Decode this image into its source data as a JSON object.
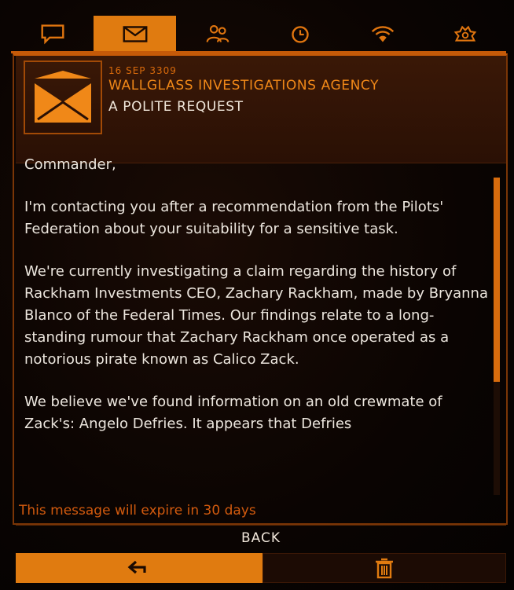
{
  "tabs": [
    {
      "icon": "chat-bubble-icon",
      "active": false
    },
    {
      "icon": "envelope-icon",
      "active": true
    },
    {
      "icon": "people-icon",
      "active": false
    },
    {
      "icon": "clock-icon",
      "active": false
    },
    {
      "icon": "wifi-shield-icon",
      "active": false
    },
    {
      "icon": "settings-cog-icon",
      "active": false
    }
  ],
  "message": {
    "date": "16 SEP 3309",
    "sender": "WALLGLASS INVESTIGATIONS AGENCY",
    "subject": "A POLITE REQUEST",
    "paragraphs": [
      "Commander,",
      "I'm contacting you after a recommendation from the Pilots' Federation about your suitability for a sensitive task.",
      "We're currently investigating a claim regarding the history of Rackham Investments CEO, Zachary Rackham, made by Bryanna Blanco of the Federal Times. Our findings relate to a long-standing rumour that Zachary Rackham once operated as a notorious pirate known as Calico Zack.",
      "We believe we've found information on an old crewmate of Zack's: Angelo Defries. It appears that Defries"
    ],
    "expiry": "This message will expire in 30 days"
  },
  "footer": {
    "back_label": "BACK",
    "reply_icon": "reply-arrow-icon",
    "delete_icon": "trash-icon"
  },
  "colors": {
    "accent": "#e07b10",
    "text": "#ece6de",
    "warning": "#d25a0e"
  }
}
